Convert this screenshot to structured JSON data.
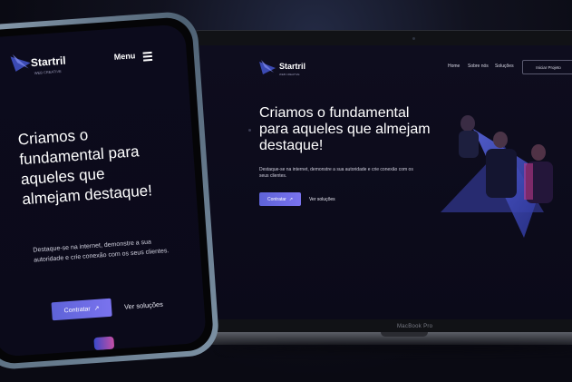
{
  "laptop": {
    "label": "MacBook Pro",
    "site": {
      "logo_text": "Startril",
      "logo_sub": "WEB CREATIVE",
      "nav": [
        "Home",
        "Sobre nós",
        "Soluções"
      ],
      "cta_outline": "Iniciar Projeto",
      "heading": "Criamos o fundamental para aqueles que almejam destaque!",
      "subtext": "Destaque-se na internet, demonstre a sua autoridade e crie conexão com os seus clientes.",
      "primary_button": "Contratar",
      "secondary_link": "Ver soluções"
    }
  },
  "phone": {
    "site": {
      "logo_text": "Startril",
      "logo_sub": "WEB CREATIVE",
      "menu": "Menu",
      "heading": "Criamos o fundamental para aqueles que almejam destaque!",
      "subtext": "Destaque-se na internet, demonstre a sua autoridade e crie conexão com os seus clientes.",
      "primary_button": "Contratar",
      "secondary_link": "Ver soluções"
    }
  },
  "colors": {
    "accent": "#6a6be0",
    "background": "#0b0a19",
    "triangle": "#3b4ab3"
  },
  "icons": [
    "logo-triangle-icon",
    "arrow-up-right-icon",
    "hamburger-icon"
  ]
}
